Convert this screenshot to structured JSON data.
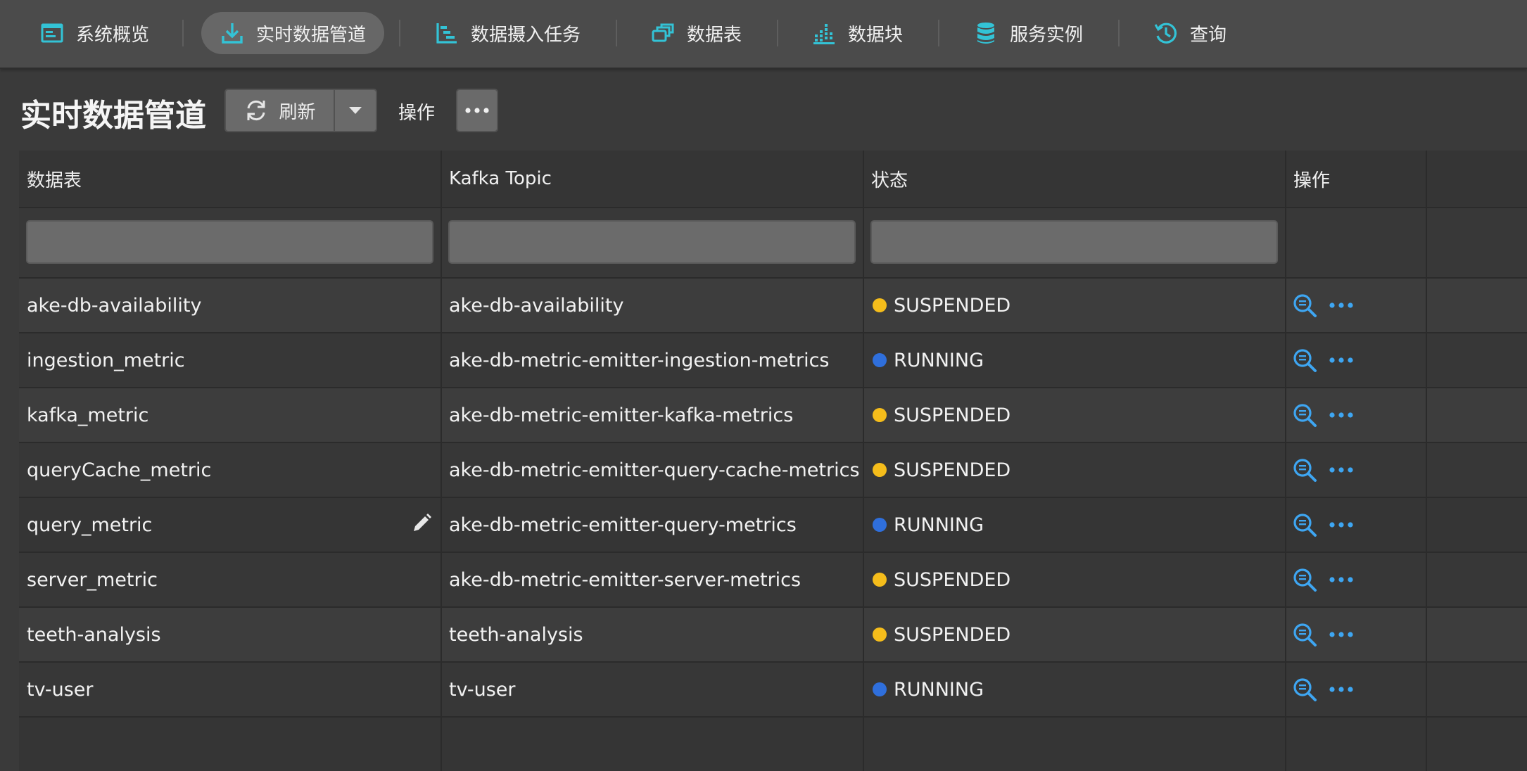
{
  "colors": {
    "accent": "#33c3d6",
    "link_blue": "#3ea6f2",
    "status_running": "#2f6fdc",
    "status_suspended": "#f5bd1b"
  },
  "nav": {
    "items": [
      {
        "label": "系统概览",
        "icon": "monitor-icon"
      },
      {
        "label": "实时数据管道",
        "icon": "download-icon",
        "active": true
      },
      {
        "label": "数据摄入任务",
        "icon": "task-tree-icon"
      },
      {
        "label": "数据表",
        "icon": "stacked-windows-icon"
      },
      {
        "label": "数据块",
        "icon": "segment-bars-icon"
      },
      {
        "label": "服务实例",
        "icon": "database-icon"
      },
      {
        "label": "查询",
        "icon": "history-icon"
      }
    ]
  },
  "page": {
    "title": "实时数据管道",
    "refresh_label": "刷新",
    "actions_label": "操作"
  },
  "table": {
    "columns": [
      "数据表",
      "Kafka Topic",
      "状态",
      "操作"
    ],
    "filters": {
      "datasource": "",
      "topic": "",
      "status": ""
    },
    "rows": [
      {
        "datasource": "ake-db-availability",
        "topic": "ake-db-availability",
        "status": "SUSPENDED"
      },
      {
        "datasource": "ingestion_metric",
        "topic": "ake-db-metric-emitter-ingestion-metrics",
        "status": "RUNNING"
      },
      {
        "datasource": "kafka_metric",
        "topic": "ake-db-metric-emitter-kafka-metrics",
        "status": "SUSPENDED"
      },
      {
        "datasource": "queryCache_metric",
        "topic": "ake-db-metric-emitter-query-cache-metrics",
        "status": "SUSPENDED"
      },
      {
        "datasource": "query_metric",
        "topic": "ake-db-metric-emitter-query-metrics",
        "status": "RUNNING",
        "editable": true
      },
      {
        "datasource": "server_metric",
        "topic": "ake-db-metric-emitter-server-metrics",
        "status": "SUSPENDED"
      },
      {
        "datasource": "teeth-analysis",
        "topic": "teeth-analysis",
        "status": "SUSPENDED"
      },
      {
        "datasource": "tv-user",
        "topic": "tv-user",
        "status": "RUNNING"
      }
    ]
  }
}
